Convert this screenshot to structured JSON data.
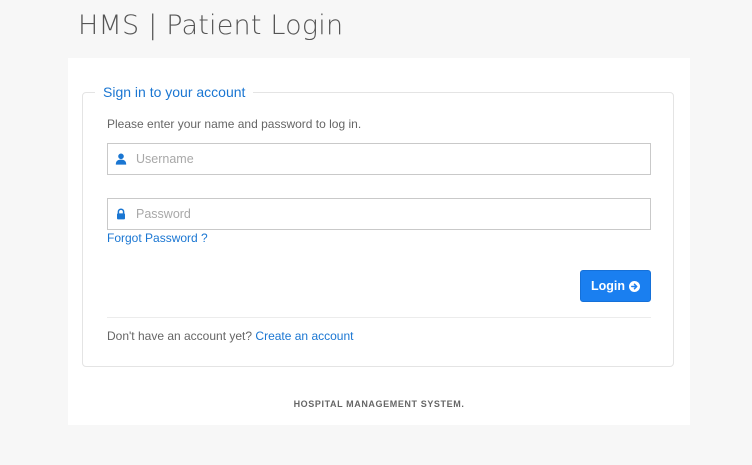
{
  "page": {
    "title": "HMS | Patient Login"
  },
  "form": {
    "legend": "Sign in to your account",
    "intro": "Please enter your name and password to log in.",
    "username": {
      "placeholder": "Username",
      "value": "",
      "icon": "user-icon"
    },
    "password": {
      "placeholder": "Password",
      "value": "",
      "icon": "lock-icon"
    },
    "forgot_label": "Forgot Password ?",
    "login_label": "Login",
    "login_icon": "arrow-circle-right-icon",
    "signup_prompt": "Don't have an account yet?",
    "signup_link": "Create an account"
  },
  "footer": {
    "text": "HOSPITAL MANAGEMENT SYSTEM."
  },
  "colors": {
    "accent": "#1a76d2",
    "button": "#1a7ff0",
    "background": "#f7f7f7"
  }
}
